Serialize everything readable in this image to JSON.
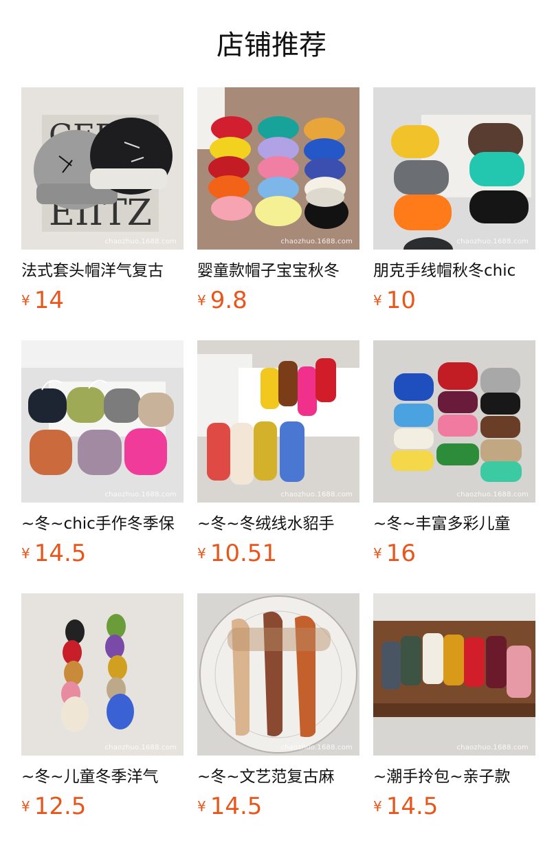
{
  "header": {
    "title": "店铺推荐"
  },
  "products": [
    {
      "name": "法式套头帽洋气复古",
      "currency": "¥",
      "price": "14",
      "watermark": "chaozhuo.1688.com"
    },
    {
      "name": "婴童款帽子宝宝秋冬",
      "currency": "¥",
      "price": "9.8",
      "watermark": "chaozhuo.1688.com"
    },
    {
      "name": "朋克手线帽秋冬chic",
      "currency": "¥",
      "price": "10",
      "watermark": "chaozhuo.1688.com"
    },
    {
      "name": "~冬~chic手作冬季保",
      "currency": "¥",
      "price": "14.5",
      "watermark": "chaozhuo.1688.com"
    },
    {
      "name": "~冬~冬绒线水貂手",
      "currency": "¥",
      "price": "10.51",
      "watermark": "chaozhuo.1688.com"
    },
    {
      "name": "~冬~丰富多彩儿童",
      "currency": "¥",
      "price": "16",
      "watermark": "chaozhuo.1688.com"
    },
    {
      "name": "~冬~儿童冬季洋气",
      "currency": "¥",
      "price": "12.5",
      "watermark": "chaozhuo.1688.com"
    },
    {
      "name": "~冬~文艺范复古麻",
      "currency": "¥",
      "price": "14.5",
      "watermark": "chaozhuo.1688.com"
    },
    {
      "name": "~潮手拎包~亲子款",
      "currency": "¥",
      "price": "14.5",
      "watermark": "chaozhuo.1688.com"
    }
  ],
  "colors": {
    "price": "#e8561b",
    "title": "#111111"
  }
}
